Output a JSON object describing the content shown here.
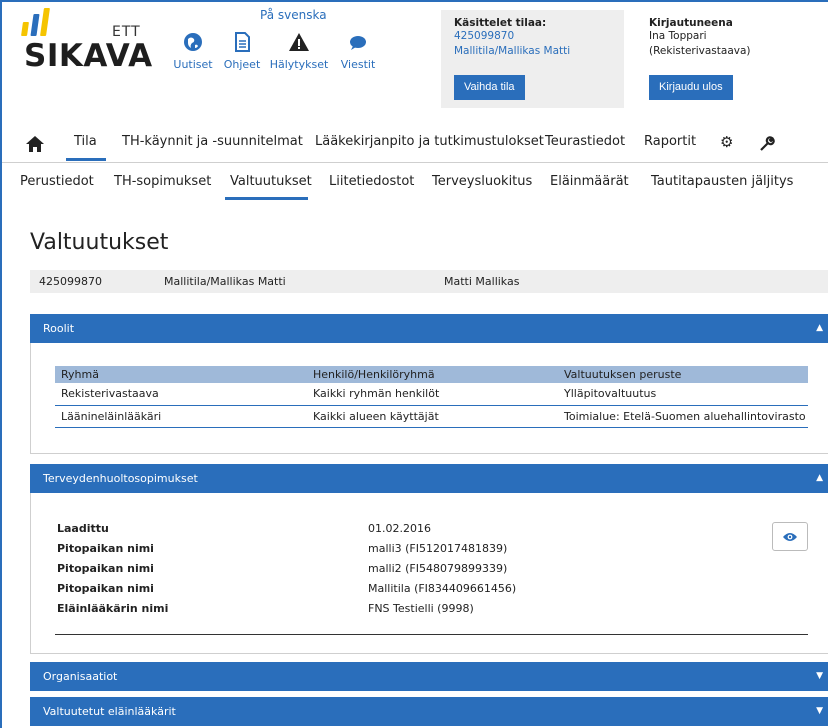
{
  "logo": {
    "small": "ETT",
    "big": "SIKAVA"
  },
  "lang_link": "På svenska",
  "topnav": [
    {
      "label": "Uutiset",
      "icon": "globe-icon"
    },
    {
      "label": "Ohjeet",
      "icon": "document-icon"
    },
    {
      "label": "Hälytykset",
      "icon": "warning-icon"
    },
    {
      "label": "Viestit",
      "icon": "chat-icon"
    }
  ],
  "tila": {
    "label": "Käsittelet tilaa:",
    "id": "425099870",
    "name": "Mallitila/Mallikas Matti",
    "button": "Vaihda tila"
  },
  "user": {
    "label": "Kirjautuneena",
    "name": "Ina Toppari",
    "role": "(Rekisterivastaava)",
    "button": "Kirjaudu ulos"
  },
  "mainnav": [
    "Tila",
    "TH-käynnit ja -suunnitelmat",
    "Lääkekirjanpito ja tutkimustulokset",
    "Teurastiedot",
    "Raportit"
  ],
  "subnav": [
    "Perustiedot",
    "TH-sopimukset",
    "Valtuutukset",
    "Liitetiedostot",
    "Terveysluokitus",
    "Eläinmäärät",
    "Tautitapausten jäljitys"
  ],
  "page_title": "Valtuutukset",
  "idbar": {
    "id": "425099870",
    "tila": "Mallitila/Mallikas Matti",
    "owner": "Matti Mallikas"
  },
  "roolit": {
    "title": "Roolit",
    "headers": [
      "Ryhmä",
      "Henkilö/Henkilöryhmä",
      "Valtuutuksen peruste"
    ],
    "rows": [
      [
        "Rekisterivastaava",
        "Kaikki ryhmän henkilöt",
        "Ylläpitovaltuutus"
      ],
      [
        "Läänineläinlääkäri",
        "Kaikki alueen käyttäjät",
        "Toimialue: Etelä-Suomen aluehallintovirasto"
      ]
    ]
  },
  "th": {
    "title": "Terveydenhuoltosopimukset",
    "rows": [
      {
        "key": "Laadittu",
        "value": "01.02.2016"
      },
      {
        "key": "Pitopaikan nimi",
        "value": "malli3 (FI512017481839)"
      },
      {
        "key": "Pitopaikan nimi",
        "value": "malli2 (FI548079899339)"
      },
      {
        "key": "Pitopaikan nimi",
        "value": "Mallitila (FI834409661456)"
      },
      {
        "key": "Eläinlääkärin nimi",
        "value": "FNS Testielli (9998)"
      }
    ]
  },
  "organisaatiot": {
    "title": "Organisaatiot"
  },
  "valtuutetut": {
    "title": "Valtuutetut eläinlääkärit"
  },
  "colors": {
    "accent": "#2a6ebb",
    "header_row": "#9fb9d9",
    "logo_yellow": "#f5c400",
    "logo_blue": "#2a6ebb"
  }
}
